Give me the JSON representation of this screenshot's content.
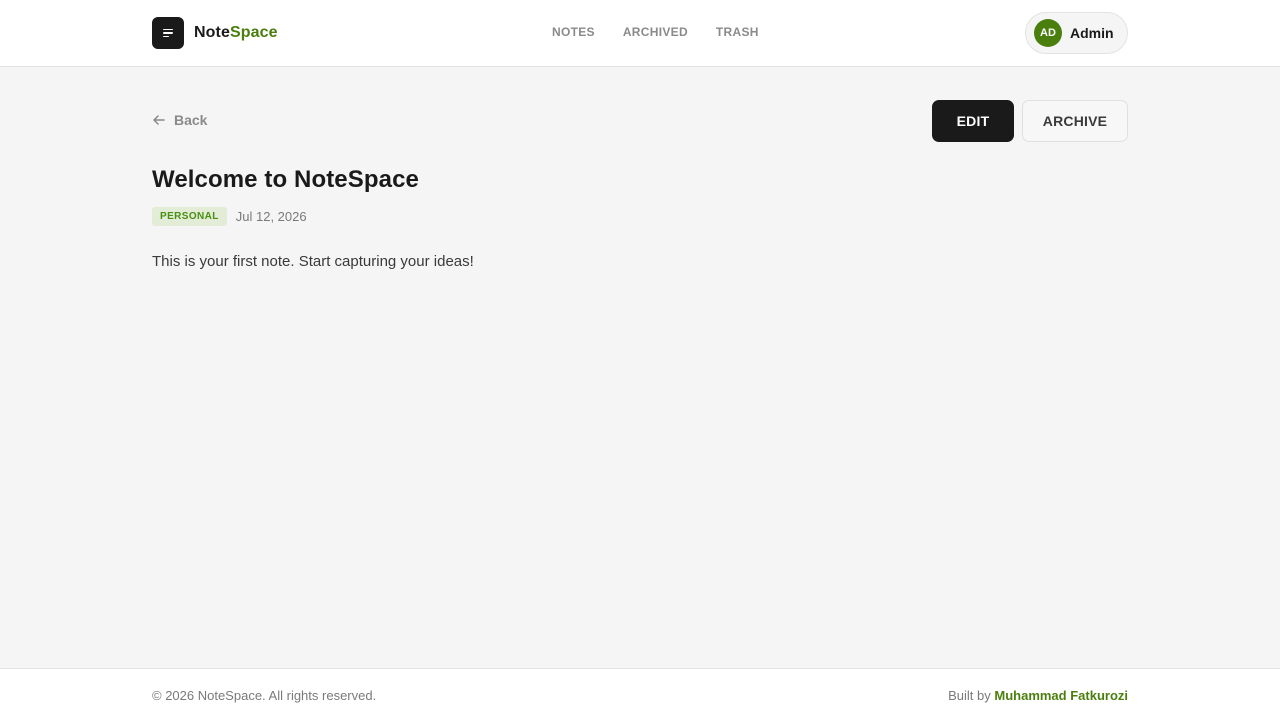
{
  "brand": {
    "name_part1": "Note",
    "name_part2": "Space",
    "icon": "note-lines-icon"
  },
  "nav": {
    "notes": "NOTES",
    "archived": "ARCHIVED",
    "trash": "TRASH"
  },
  "user": {
    "initials": "AD",
    "name": "Admin"
  },
  "toolbar": {
    "back_label": "Back",
    "edit_label": "EDIT",
    "archive_label": "ARCHIVE"
  },
  "note": {
    "title": "Welcome to NoteSpace",
    "tag": "PERSONAL",
    "date": "Jul 12, 2026",
    "body": "This is your first note. Start capturing your ideas!"
  },
  "footer": {
    "copyright": "© 2026 NoteSpace. All rights reserved.",
    "built_by_prefix": "Built by",
    "author": "Muhammad Fatkurozi"
  },
  "colors": {
    "accent": "#4a7f0e",
    "dark": "#1a1a1a",
    "background": "#f5f5f5"
  }
}
